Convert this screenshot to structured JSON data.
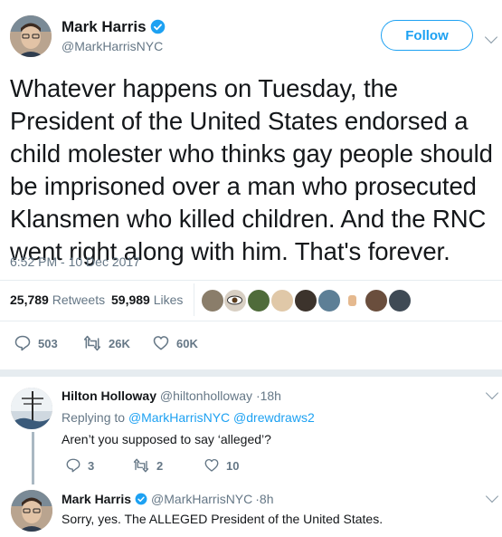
{
  "main_tweet": {
    "author_name": "Mark Harris",
    "handle": "@MarkHarrisNYC",
    "follow_label": "Follow",
    "text": "Whatever happens on Tuesday, the President of the United States endorsed a child molester who thinks gay people should be imprisoned over a man who prosecuted Klansmen who killed children. And the RNC went right along with him. That's forever.",
    "timestamp": "6:52 PM - 10 Dec 2017",
    "retweets_count": "25,789",
    "retweets_label": "Retweets",
    "likes_count": "59,989",
    "likes_label": "Likes",
    "actions": {
      "replies": "503",
      "retweets": "26K",
      "likes": "60K"
    }
  },
  "reply_1": {
    "author_name": "Hilton Holloway",
    "handle": "@hiltonholloway",
    "time": "·18h",
    "replying_to_prefix": "Replying to",
    "replying_to_1": "@MarkHarrisNYC",
    "replying_to_2": "@drewdraws2",
    "text": "Aren’t you supposed to say ‘alleged’?",
    "actions": {
      "replies": "3",
      "retweets": "2",
      "likes": "10"
    }
  },
  "reply_2": {
    "author_name": "Mark Harris",
    "handle": "@MarkHarrisNYC",
    "time": "·8h",
    "text": "Sorry, yes. The ALLEGED President of the United States."
  },
  "colors": {
    "accent": "#1da1f2",
    "secondary_text": "#657786",
    "divider": "#e6ecf0"
  },
  "icons": [
    "verified-badge-icon",
    "chevron-down-icon",
    "reply-icon",
    "retweet-icon",
    "heart-icon"
  ]
}
